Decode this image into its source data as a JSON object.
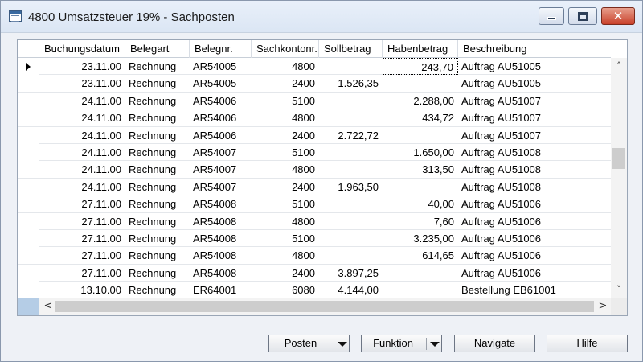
{
  "window": {
    "title": "4800 Umsatzsteuer 19% - Sachposten",
    "close_glyph": "✕"
  },
  "table": {
    "columns": [
      "Buchungsdatum",
      "Belegart",
      "Belegnr.",
      "Sachkontonr.",
      "Sollbetrag",
      "Habenbetrag",
      "Beschreibung"
    ],
    "rows": [
      [
        "23.11.00",
        "Rechnung",
        "AR54005",
        "4800",
        "",
        "243,70",
        "Auftrag AU51005"
      ],
      [
        "23.11.00",
        "Rechnung",
        "AR54005",
        "2400",
        "1.526,35",
        "",
        "Auftrag AU51005"
      ],
      [
        "24.11.00",
        "Rechnung",
        "AR54006",
        "5100",
        "",
        "2.288,00",
        "Auftrag AU51007"
      ],
      [
        "24.11.00",
        "Rechnung",
        "AR54006",
        "4800",
        "",
        "434,72",
        "Auftrag AU51007"
      ],
      [
        "24.11.00",
        "Rechnung",
        "AR54006",
        "2400",
        "2.722,72",
        "",
        "Auftrag AU51007"
      ],
      [
        "24.11.00",
        "Rechnung",
        "AR54007",
        "5100",
        "",
        "1.650,00",
        "Auftrag AU51008"
      ],
      [
        "24.11.00",
        "Rechnung",
        "AR54007",
        "4800",
        "",
        "313,50",
        "Auftrag AU51008"
      ],
      [
        "24.11.00",
        "Rechnung",
        "AR54007",
        "2400",
        "1.963,50",
        "",
        "Auftrag AU51008"
      ],
      [
        "27.11.00",
        "Rechnung",
        "AR54008",
        "5100",
        "",
        "40,00",
        "Auftrag AU51006"
      ],
      [
        "27.11.00",
        "Rechnung",
        "AR54008",
        "4800",
        "",
        "7,60",
        "Auftrag AU51006"
      ],
      [
        "27.11.00",
        "Rechnung",
        "AR54008",
        "5100",
        "",
        "3.235,00",
        "Auftrag AU51006"
      ],
      [
        "27.11.00",
        "Rechnung",
        "AR54008",
        "4800",
        "",
        "614,65",
        "Auftrag AU51006"
      ],
      [
        "27.11.00",
        "Rechnung",
        "AR54008",
        "2400",
        "3.897,25",
        "",
        "Auftrag AU51006"
      ],
      [
        "13.10.00",
        "Rechnung",
        "ER64001",
        "6080",
        "4.144,00",
        "",
        "Bestellung EB61001"
      ]
    ],
    "current_row": 0,
    "focused_cell": {
      "row": 0,
      "col": 5
    }
  },
  "scroll": {
    "up": "˄",
    "down": "˅",
    "left": "<",
    "right": ">"
  },
  "buttons": {
    "posten": "Posten",
    "funktion": "Funktion",
    "navigate": "Navigate",
    "hilfe": "Hilfe"
  },
  "colors": {
    "selector_corner": "#b5cde6",
    "close_button": "#c8402a"
  }
}
